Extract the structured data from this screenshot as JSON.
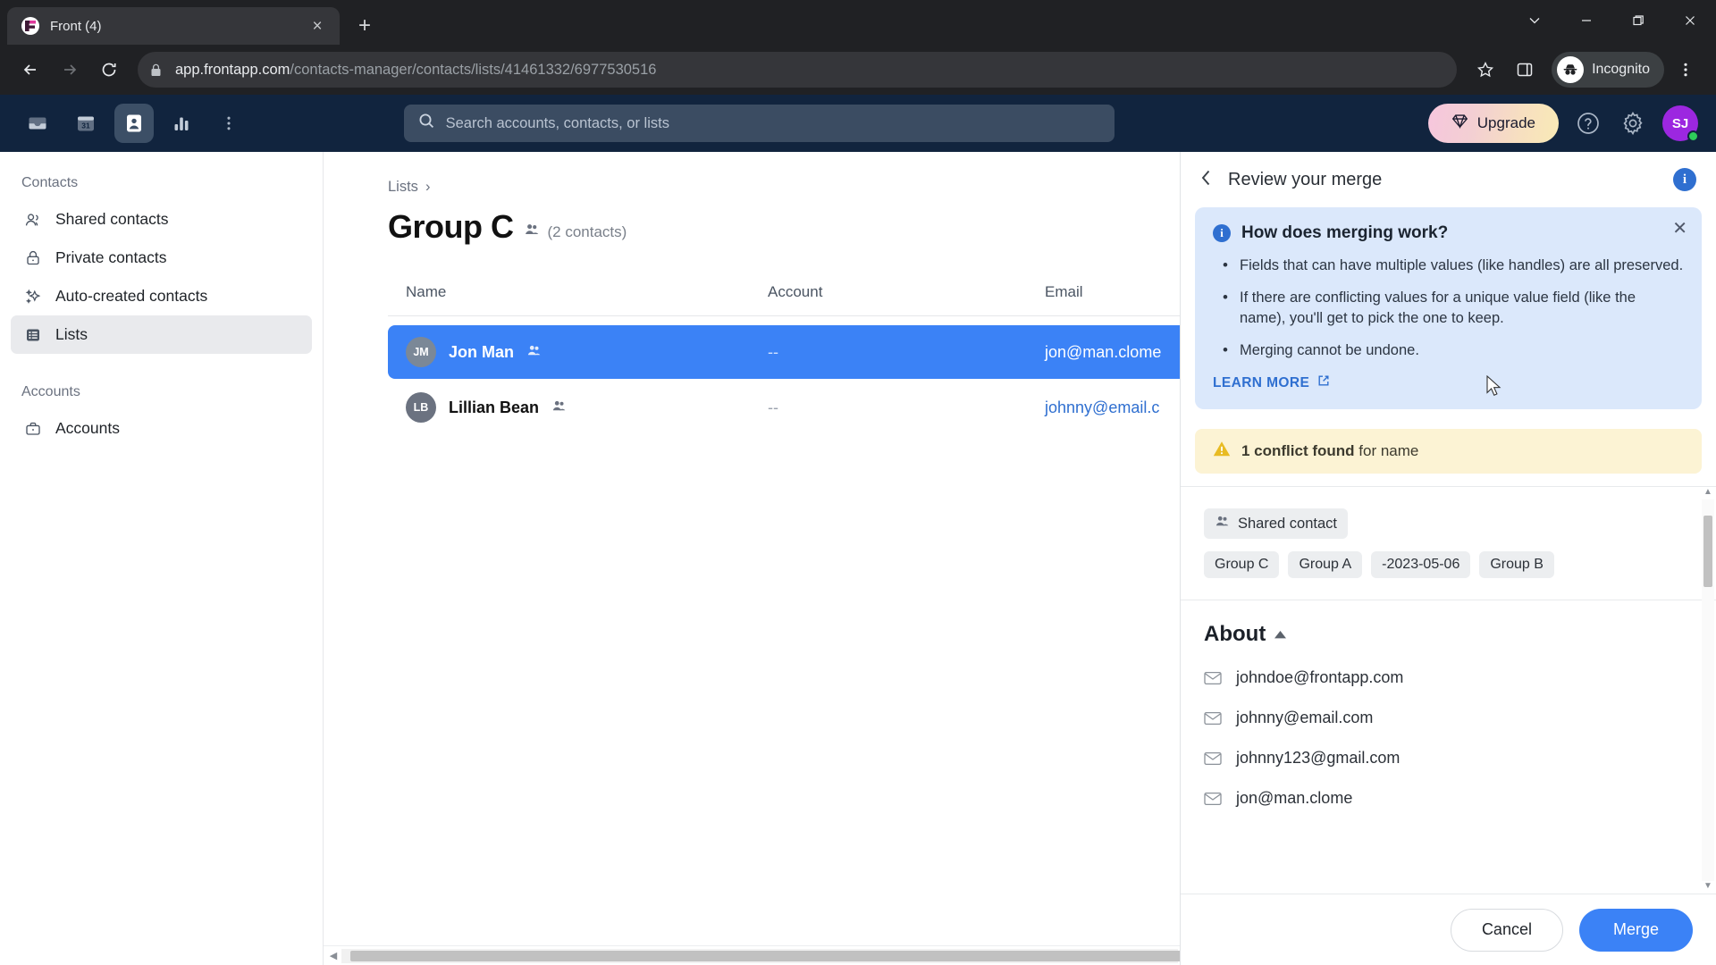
{
  "browser": {
    "tab": {
      "title": "Front (4)",
      "favicon": "front-logo",
      "close_label": "×"
    },
    "new_tab_label": "+",
    "window_controls": {
      "minimize": "—",
      "maximize": "❐",
      "close": "✕",
      "more": "⌄"
    },
    "nav": {
      "back": "←",
      "forward": "→",
      "reload": "⟳"
    },
    "url": {
      "domain": "app.frontapp.com",
      "path": "/contacts-manager/contacts/lists/41461332/6977530516"
    },
    "profile_label": "Incognito",
    "bookmark_icon": "star-icon",
    "side_panel_icon": "side-panel-icon",
    "menu_icon": "kebab-menu-icon"
  },
  "app_header": {
    "nav_items": [
      {
        "name": "inbox",
        "icon": "inbox-icon",
        "active": false
      },
      {
        "name": "calendar",
        "icon": "calendar-icon",
        "active": false,
        "label": "31"
      },
      {
        "name": "contacts",
        "icon": "contacts-icon",
        "active": true
      },
      {
        "name": "analytics",
        "icon": "bar-chart-icon",
        "active": false
      }
    ],
    "more_icon": "vertical-dots-icon",
    "search": {
      "placeholder": "Search accounts, contacts, or lists",
      "value": "",
      "icon": "search-icon"
    },
    "upgrade_label": "Upgrade",
    "upgrade_icon": "diamond-icon",
    "help_icon": "help-circle-icon",
    "settings_icon": "gear-icon",
    "avatar_initials": "SJ"
  },
  "sidebar": {
    "sections": [
      {
        "label": "Contacts",
        "items": [
          {
            "label": "Shared contacts",
            "icon": "people-icon",
            "active": false
          },
          {
            "label": "Private contacts",
            "icon": "lock-icon",
            "active": false
          },
          {
            "label": "Auto-created contacts",
            "icon": "sparkle-icon",
            "active": false
          },
          {
            "label": "Lists",
            "icon": "list-icon",
            "active": true
          }
        ]
      },
      {
        "label": "Accounts",
        "items": [
          {
            "label": "Accounts",
            "icon": "briefcase-icon",
            "active": false
          }
        ]
      }
    ]
  },
  "main": {
    "breadcrumb": {
      "root": "Lists",
      "separator": "›"
    },
    "title": "Group C",
    "contacts_count": "(2 contacts)",
    "shared_icon": "people-icon",
    "table": {
      "columns": [
        "Name",
        "Account",
        "Email"
      ],
      "rows": [
        {
          "initials": "JM",
          "name": "Jon Man",
          "shared_icon": "people-icon",
          "account": "--",
          "email": "jon@man.clome",
          "selected": true
        },
        {
          "initials": "LB",
          "name": "Lillian Bean",
          "shared_icon": "people-icon",
          "account": "--",
          "email": "johnny@email.c",
          "selected": false
        }
      ]
    },
    "hscroll": {
      "left_arrow": "◀",
      "right_arrow": "▶"
    }
  },
  "panel": {
    "back_icon": "chevron-left-icon",
    "title": "Review your merge",
    "info_badge": "i",
    "info_card": {
      "heading": "How does merging work?",
      "close_label": "✕",
      "bullets": [
        "Fields that can have multiple values (like handles) are all preserved.",
        "If there are conflicting values for a unique value field (like the name), you'll get to pick the one to keep.",
        "Merging cannot be undone."
      ],
      "learn_more": "LEARN MORE",
      "external_icon": "external-link-icon"
    },
    "conflict": {
      "icon": "warning-triangle-icon",
      "bold_text": "1 conflict found",
      "rest_text": "for name"
    },
    "contact_type": {
      "icon": "people-icon",
      "label": "Shared contact"
    },
    "tags": [
      "Group C",
      "Group A",
      "-2023-05-06",
      "Group B"
    ],
    "about": {
      "heading": "About",
      "collapse_icon": "caret-up-icon",
      "emails": [
        "johndoe@frontapp.com",
        "johnny@email.com",
        "johnny123@gmail.com",
        "jon@man.clome"
      ],
      "email_icon": "envelope-icon"
    },
    "scroll": {
      "up_arrow": "▲",
      "down_arrow": "▼"
    },
    "footer": {
      "cancel_label": "Cancel",
      "merge_label": "Merge"
    }
  },
  "colors": {
    "accent_blue": "#3b82f6",
    "link_blue": "#2f6fd0",
    "header_navy": "#11243e",
    "info_bg": "#dbe8fb",
    "warning_bg": "#fcf3d4",
    "avatar_purple": "#9c27e0"
  }
}
